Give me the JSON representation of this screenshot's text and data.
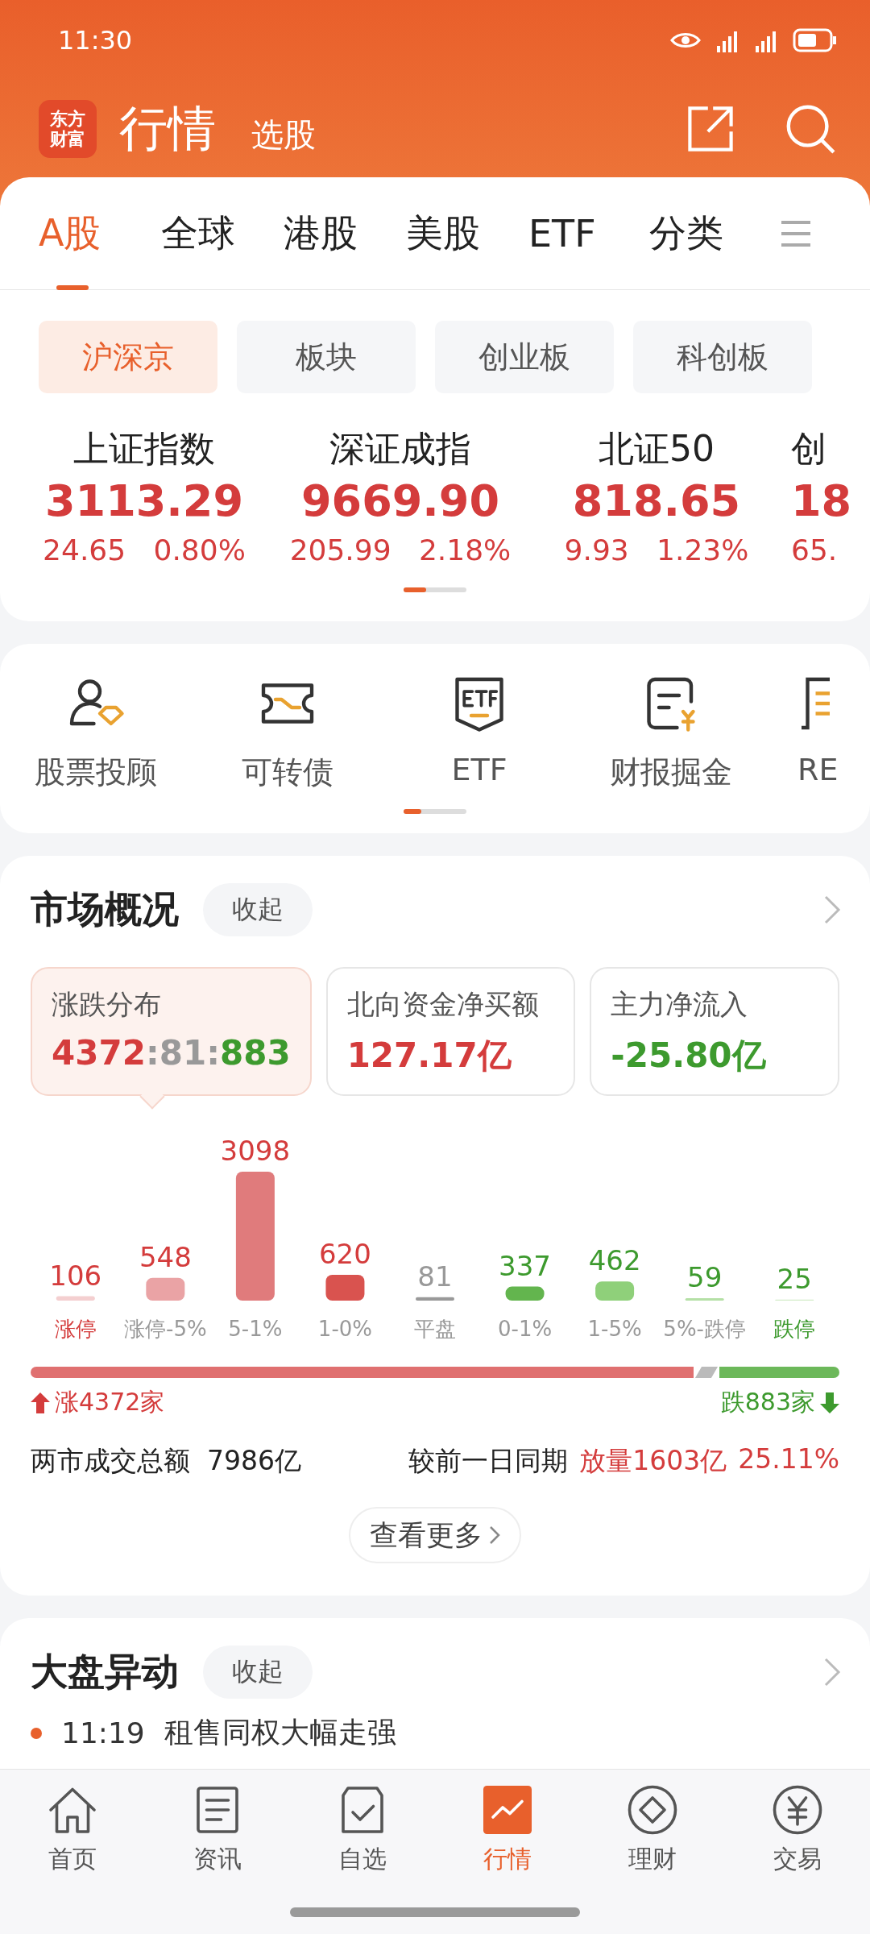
{
  "status_bar": {
    "time": "11:30"
  },
  "header": {
    "logo_lines": [
      "东方",
      "财富"
    ],
    "title": "行情",
    "subtitle": "选股"
  },
  "market_tabs": [
    {
      "label": "A股",
      "selected": true
    },
    {
      "label": "全球",
      "selected": false
    },
    {
      "label": "港股",
      "selected": false
    },
    {
      "label": "美股",
      "selected": false
    },
    {
      "label": "ETF",
      "selected": false
    },
    {
      "label": "分类",
      "selected": false
    }
  ],
  "chips": [
    {
      "label": "沪深京",
      "selected": true
    },
    {
      "label": "板块",
      "selected": false
    },
    {
      "label": "创业板",
      "selected": false
    },
    {
      "label": "科创板",
      "selected": false
    }
  ],
  "indices": [
    {
      "name": "上证指数",
      "value": "3113.29",
      "change": "24.65",
      "percent": "0.80%"
    },
    {
      "name": "深证成指",
      "value": "9669.90",
      "change": "205.99",
      "percent": "2.18%"
    },
    {
      "name": "北证50",
      "value": "818.65",
      "change": "9.93",
      "percent": "1.23%"
    },
    {
      "name": "创",
      "value": "18",
      "change": "65."
    }
  ],
  "shortcuts": [
    {
      "label": "股票投顾"
    },
    {
      "label": "可转债"
    },
    {
      "label": "ETF"
    },
    {
      "label": "财报掘金"
    },
    {
      "label": "RE"
    }
  ],
  "market_overview": {
    "title": "市场概况",
    "collapse": "收起",
    "stats": [
      {
        "label": "涨跌分布",
        "selected": true,
        "parts": [
          {
            "text": "4372",
            "color": "#d43c3c"
          },
          {
            "text": ":81:",
            "color": "#999999"
          },
          {
            "text": "883",
            "color": "#3d9a2e"
          }
        ]
      },
      {
        "label": "北向资金净买额",
        "selected": false,
        "parts": [
          {
            "text": "127.17亿",
            "color": "#d43c3c"
          }
        ]
      },
      {
        "label": "主力净流入",
        "selected": false,
        "parts": [
          {
            "text": "-25.80亿",
            "color": "#3d9a2e"
          }
        ]
      }
    ],
    "chart_data": {
      "type": "bar",
      "categories": [
        "涨停",
        "涨停-5%",
        "5-1%",
        "1-0%",
        "平盘",
        "0-1%",
        "1-5%",
        "5%-跌停",
        "跌停"
      ],
      "values": [
        106,
        548,
        3098,
        620,
        81,
        337,
        462,
        59,
        25
      ],
      "data_labels": true
    },
    "breadth": {
      "up": "涨4372家",
      "down": "跌883家",
      "level": 0.82
    },
    "turnover": {
      "label": "两市成交总额",
      "value": "7986亿"
    },
    "compare": {
      "label": "较前一日同期",
      "change": "放量1603亿",
      "percent": "25.11%"
    },
    "more": "查看更多"
  },
  "movers": {
    "title": "大盘异动",
    "collapse": "收起",
    "items": [
      {
        "time": "11:19",
        "text": "租售同权大幅走强"
      }
    ]
  },
  "bottom_nav": [
    {
      "label": "首页",
      "selected": false
    },
    {
      "label": "资讯",
      "selected": false
    },
    {
      "label": "自选",
      "selected": false
    },
    {
      "label": "行情",
      "selected": true
    },
    {
      "label": "理财",
      "selected": false
    },
    {
      "label": "交易",
      "selected": false
    }
  ]
}
